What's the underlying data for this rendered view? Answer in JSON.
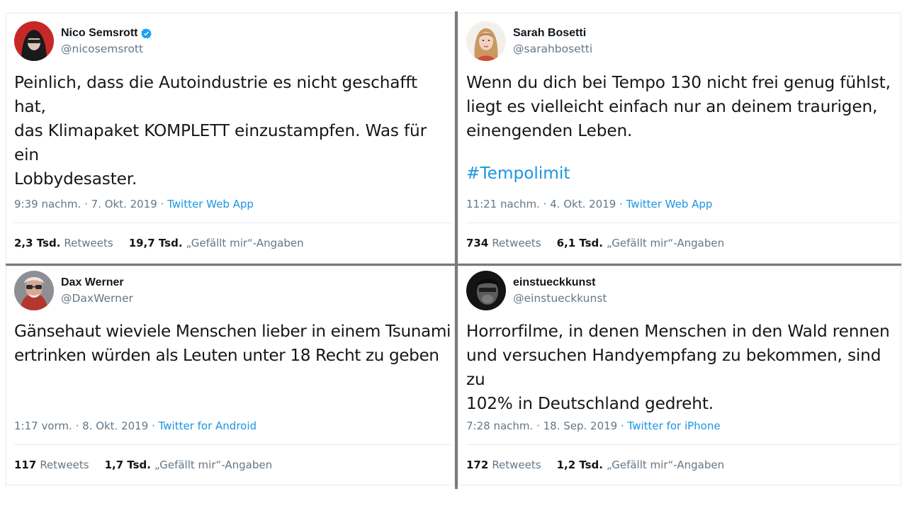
{
  "tweets": [
    {
      "display_name": "Nico Semsrott",
      "verified": true,
      "handle": "@nicosemsrott",
      "avatar_icon": "avatar-hooded-man-red",
      "text": "Peinlich, dass die Autoindustrie es nicht geschafft hat,\ndas Klimapaket KOMPLETT einzustampfen. Was für ein\nLobbydesaster.",
      "hashtag": "",
      "time": "9:39 nachm.",
      "date": "7. Okt. 2019",
      "source": "Twitter Web App",
      "retweets_num": "2,3 Tsd.",
      "retweets_label": "Retweets",
      "likes_num": "19,7 Tsd.",
      "likes_label": "„Gefällt mir“-Angaben"
    },
    {
      "display_name": "Sarah Bosetti",
      "verified": false,
      "handle": "@sarahbosetti",
      "avatar_icon": "avatar-woman-blonde",
      "text": "Wenn du dich bei Tempo 130 nicht frei genug fühlst,\nliegt es vielleicht einfach nur an deinem traurigen,\neinengenden Leben.",
      "hashtag": "#Tempolimit",
      "time": "11:21 nachm.",
      "date": "4. Okt. 2019",
      "source": "Twitter Web App",
      "retweets_num": "734",
      "retweets_label": "Retweets",
      "likes_num": "6,1 Tsd.",
      "likes_label": "„Gefällt mir“-Angaben"
    },
    {
      "display_name": "Dax Werner",
      "verified": false,
      "handle": "@DaxWerner",
      "avatar_icon": "avatar-man-sunglasses",
      "text": "Gänsehaut wieviele Menschen lieber in einem Tsunami\nertrinken würden als Leuten unter 18 Recht zu geben",
      "hashtag": "",
      "time": "1:17 vorm.",
      "date": "8. Okt. 2019",
      "source": "Twitter for Android",
      "retweets_num": "117",
      "retweets_label": "Retweets",
      "likes_num": "1,7 Tsd.",
      "likes_label": "„Gefällt mir“-Angaben"
    },
    {
      "display_name": "einstueckkunst",
      "verified": false,
      "handle": "@einstueckkunst",
      "avatar_icon": "avatar-dark-portrait",
      "text": "Horrorfilme, in denen Menschen in den Wald rennen\nund versuchen Handyempfang zu bekommen, sind zu\n102% in Deutschland gedreht.",
      "hashtag": "",
      "time": "7:28 nachm.",
      "date": "18. Sep. 2019",
      "source": "Twitter for iPhone",
      "retweets_num": "172",
      "retweets_label": "Retweets",
      "likes_num": "1,2 Tsd.",
      "likes_label": "„Gefällt mir“-Angaben"
    }
  ],
  "colors": {
    "text": "#14171a",
    "muted": "#657786",
    "link": "#1b95e0",
    "verified": "#1da1f2",
    "divider": "#e6ecf0",
    "grid_line": "#7a7a7a"
  }
}
